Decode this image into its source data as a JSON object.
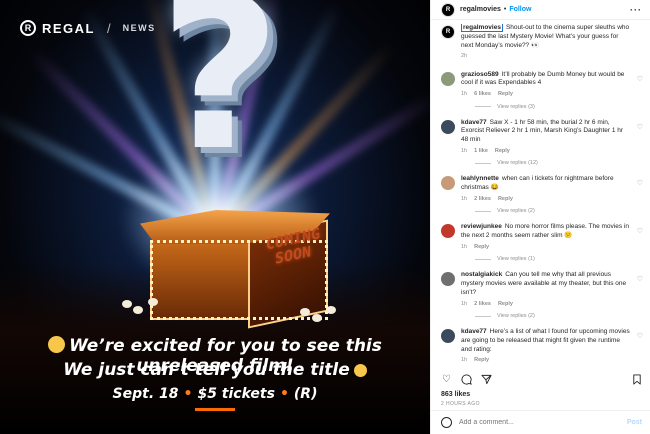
{
  "image": {
    "brand": "REGAL",
    "brand_mark": "R",
    "section": "NEWS",
    "box_sign": [
      "COMING",
      "SOON"
    ],
    "line1": "We’re excited for you to see this unreleased film!",
    "line2": "We just can’t tell you the title",
    "details": [
      "Sept. 18",
      "$5 tickets",
      "(R)"
    ],
    "accent_color": "#ff6a00"
  },
  "header": {
    "username": "regalmovies",
    "follow_label": "Follow",
    "verified_icon": "verified-badge-icon",
    "more_icon": "more-options-icon"
  },
  "caption": {
    "username": "regalmovies",
    "text": "Shout-out to the cinema super sleuths who guessed the last Mystery Movie! What’s your guess for next Monday’s movie?? 👀",
    "time": "2h"
  },
  "comments": [
    {
      "user": "grazioso589",
      "text": "It’ll probably be Dumb Money but would be cool if it was Expendables 4",
      "time": "1h",
      "likes": "6 likes",
      "reply": "Reply",
      "replies": "View replies (3)",
      "avatar_color": "#8a9a7a"
    },
    {
      "user": "kdave77",
      "text": "Saw X - 1 hr 58 min, the burial 2 hr 6 min, Exorcist Reliever 2 hr 1 min, Marsh King’s Daughter 1 hr 48 min",
      "time": "1h",
      "likes": "1 like",
      "reply": "Reply",
      "replies": "View replies (12)",
      "avatar_color": "#3b4a5c"
    },
    {
      "user": "leahlynnette",
      "text": "when can i tickets for nightmare before christmas 😂",
      "time": "1h",
      "likes": "2 likes",
      "reply": "Reply",
      "replies": "View replies (2)",
      "avatar_color": "#c79a7a"
    },
    {
      "user": "reviewjunkee",
      "text": "No more horror films please. The movies in the next 2 months seem rather slim 😕",
      "time": "1h",
      "likes": "",
      "reply": "Reply",
      "replies": "View replies (1)",
      "avatar_color": "#c0392b"
    },
    {
      "user": "nostalgiakick",
      "text": "Can you tell me why that all previous mystery movies were available at my theater, but this one isn’t?",
      "time": "1h",
      "likes": "2 likes",
      "reply": "Reply",
      "replies": "View replies (2)",
      "avatar_color": "#6f6f6f"
    },
    {
      "user": "kdave77",
      "text": "Here’s a list of what I found for upcoming movies are going to be released that might fit given the runtime and rating:",
      "time": "1h",
      "likes": "",
      "reply": "Reply",
      "replies": "",
      "avatar_color": "#3b4a5c"
    }
  ],
  "actions": {
    "like_icon": "heart-icon",
    "comment_icon": "comment-bubble-icon",
    "share_icon": "share-plane-icon",
    "save_icon": "bookmark-icon"
  },
  "likes": "863 likes",
  "posted_ago": "2 HOURS AGO",
  "add_comment": {
    "placeholder": "Add a comment...",
    "post_label": "Post",
    "emoji_icon": "emoji-smile-icon"
  }
}
